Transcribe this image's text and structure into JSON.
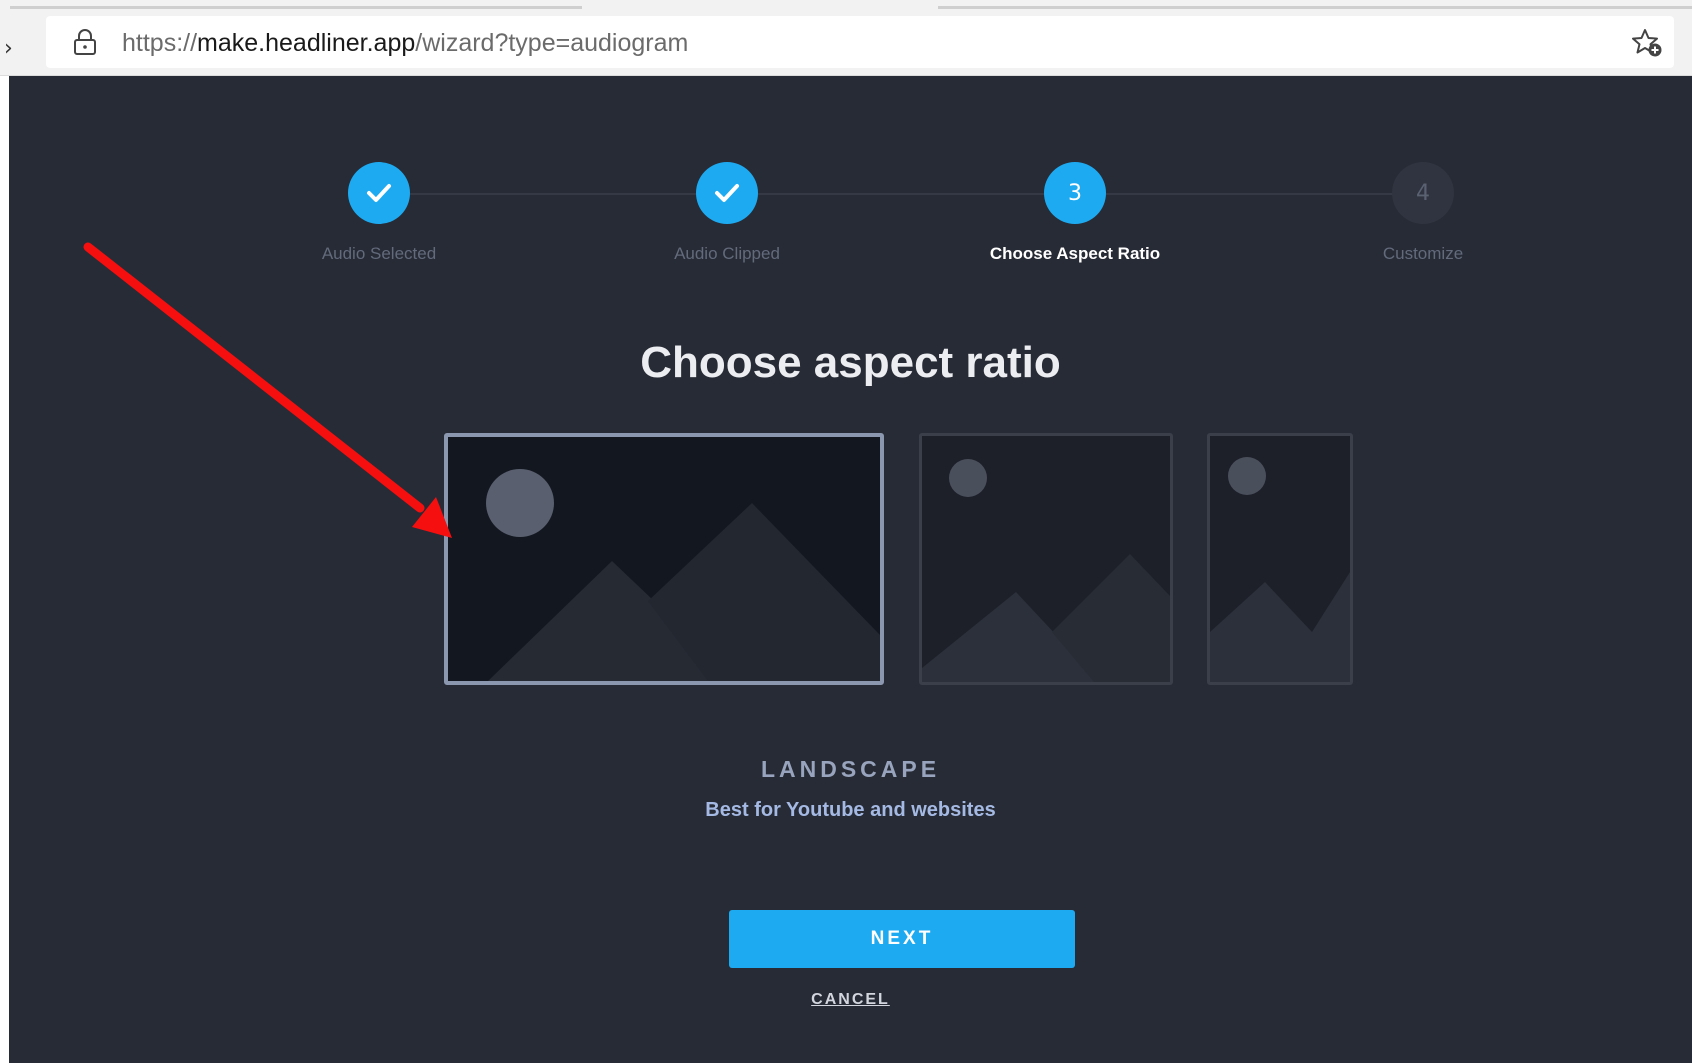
{
  "browser": {
    "url_scheme": "https://",
    "url_host": "make.headliner.app",
    "url_path": "/wizard?type=audiogram",
    "icons": {
      "lock": "lock-icon",
      "bookmark": "star-add-icon"
    }
  },
  "wizard": {
    "steps": [
      {
        "label": "Audio Selected",
        "state": "done",
        "icon": "check-icon"
      },
      {
        "label": "Audio Clipped",
        "state": "done",
        "icon": "check-icon"
      },
      {
        "label": "Choose Aspect Ratio",
        "state": "active",
        "number": "3"
      },
      {
        "label": "Customize",
        "state": "todo",
        "number": "4"
      }
    ],
    "title": "Choose aspect ratio",
    "options": [
      {
        "name": "landscape",
        "selected": true,
        "icon": "image-placeholder-icon"
      },
      {
        "name": "square",
        "selected": false,
        "icon": "image-placeholder-icon"
      },
      {
        "name": "portrait",
        "selected": false,
        "icon": "image-placeholder-icon"
      }
    ],
    "selected_name": "LANDSCAPE",
    "selected_description": "Best for Youtube and websites",
    "next_label": "NEXT",
    "cancel_label": "CANCEL"
  },
  "colors": {
    "accent": "#1eaaf1",
    "background": "#272b35",
    "annotation_arrow": "#f50f0f"
  }
}
